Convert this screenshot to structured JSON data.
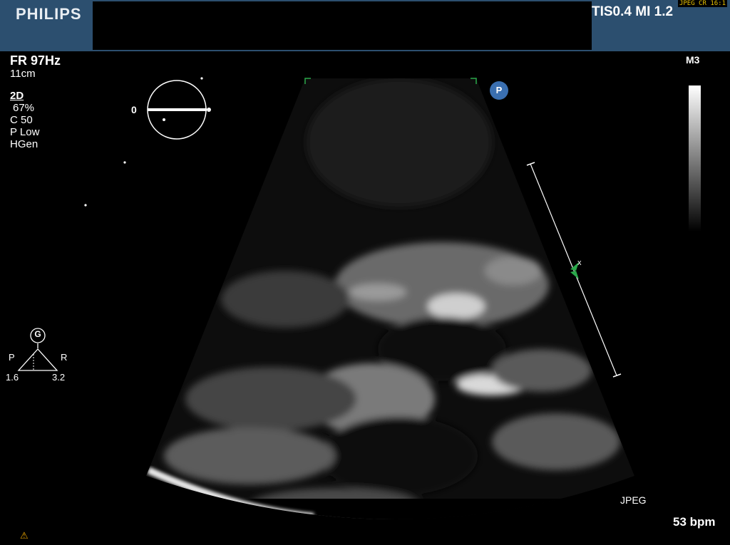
{
  "header": {
    "brand": "PHILIPS",
    "thermal_mech_index": "TIS0.4   MI 1.2",
    "compression_tag": "JPEG CR 16:1"
  },
  "params": {
    "frame_rate": "FR 97Hz",
    "depth": "11cm",
    "mode": "2D",
    "gain": "67%",
    "compression": "C 50",
    "power": "P Low",
    "frequency": "HGen"
  },
  "probe": {
    "angle": "0",
    "orientation_badge": "P"
  },
  "colormap": {
    "label": "M3"
  },
  "orientation_marker": {
    "symbol": "G",
    "left_label": "P",
    "right_label": "R",
    "left_value": "1.6",
    "right_value": "3.2"
  },
  "footer": {
    "format": "JPEG",
    "heart_rate": "53 bpm",
    "warning_icon": "warning-triangle-icon"
  },
  "colors": {
    "header_bg": "#2c4f6f",
    "badge_blue": "#3a6fb0",
    "warning": "#e8a400",
    "focus_marker": "#2aa84a"
  }
}
